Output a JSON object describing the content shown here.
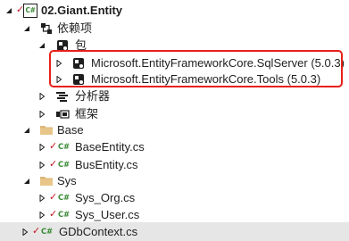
{
  "solution_explorer": {
    "project": {
      "name": "02.Giant.Entity",
      "badge": "C#"
    },
    "dependencies": {
      "label": "依赖项",
      "packages": {
        "label": "包",
        "items": [
          {
            "label": "Microsoft.EntityFrameworkCore.SqlServer (5.0.3)"
          },
          {
            "label": "Microsoft.EntityFrameworkCore.Tools (5.0.3)"
          }
        ]
      },
      "analyzers": {
        "label": "分析器"
      },
      "frameworks": {
        "label": "框架"
      }
    },
    "folders": [
      {
        "name": "Base",
        "files": [
          {
            "name": "BaseEntity.cs",
            "badge": "C#"
          },
          {
            "name": "BusEntity.cs",
            "badge": "C#"
          }
        ]
      },
      {
        "name": "Sys",
        "files": [
          {
            "name": "Sys_Org.cs",
            "badge": "C#"
          },
          {
            "name": "Sys_User.cs",
            "badge": "C#"
          }
        ]
      }
    ],
    "root_files": [
      {
        "name": "GDbContext.cs",
        "badge": "C#",
        "selected": true
      }
    ]
  },
  "colors": {
    "highlight_border": "#e8201a",
    "csharp_green": "#388a34",
    "checkmark_red": "#c4161c",
    "folder_yellow": "#dcb67a",
    "selected_row": "#e6e6e6"
  },
  "icons": {
    "project": "csharp-project-icon",
    "dependencies": "dependencies-icon",
    "packages": "package-icon",
    "package_item": "nuget-package-icon",
    "analyzers": "analyzer-icon",
    "frameworks": "framework-icon",
    "folder": "folder-icon",
    "file": "csharp-file-icon",
    "checkmark": "pending-add-check-icon",
    "expanded": "expanded-arrow-icon",
    "collapsed": "collapsed-arrow-icon"
  }
}
